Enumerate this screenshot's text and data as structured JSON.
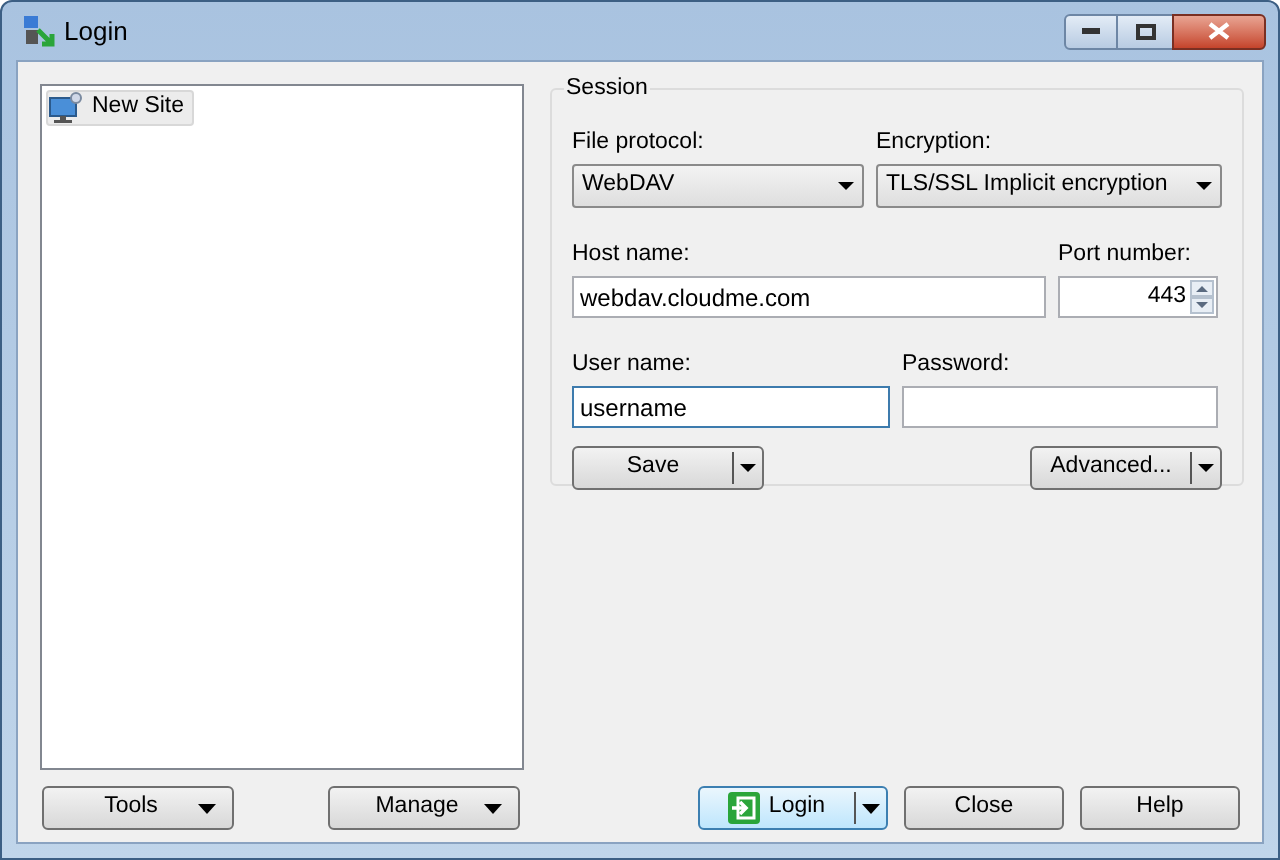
{
  "window": {
    "title": "Login"
  },
  "sites": [
    {
      "label": "New Site",
      "selected": true
    }
  ],
  "session": {
    "title": "Session",
    "file_protocol": {
      "label": "File protocol:",
      "value": "WebDAV"
    },
    "encryption": {
      "label": "Encryption:",
      "value": "TLS/SSL Implicit encryption"
    },
    "host_name": {
      "label": "Host name:",
      "value": "webdav.cloudme.com"
    },
    "port_number": {
      "label": "Port number:",
      "value": "443"
    },
    "user_name": {
      "label": "User name:",
      "value": "username",
      "focused": true
    },
    "password": {
      "label": "Password:"
    },
    "save_button": "Save",
    "advanced_button": "Advanced..."
  },
  "buttons": [
    {
      "label": "Tools",
      "kind": "menu",
      "default": false
    },
    {
      "label": "Manage",
      "kind": "menu",
      "default": false
    },
    {
      "label": "Login",
      "kind": "split",
      "default": true
    },
    {
      "label": "Close",
      "kind": "plain",
      "default": false
    },
    {
      "label": "Help",
      "kind": "plain",
      "default": false
    }
  ]
}
